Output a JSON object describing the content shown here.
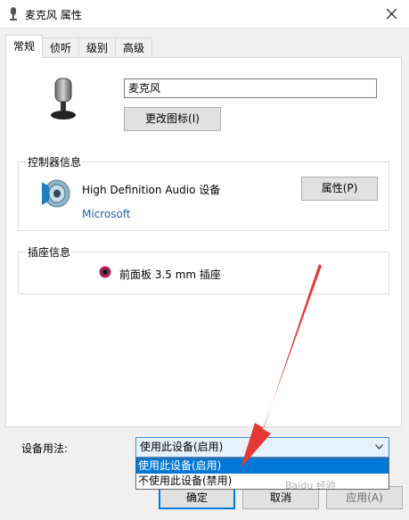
{
  "window": {
    "title": "麦克风 属性",
    "close_icon": "close-icon",
    "title_icon": "microphone-icon"
  },
  "tabs": [
    {
      "label": "常规",
      "active": true
    },
    {
      "label": "侦听",
      "active": false
    },
    {
      "label": "级别",
      "active": false
    },
    {
      "label": "高级",
      "active": false
    }
  ],
  "general": {
    "device_name_value": "麦克风",
    "change_icon_label": "更改图标(I)",
    "controller": {
      "legend": "控制器信息",
      "device": "High Definition Audio 设备",
      "vendor": "Microsoft",
      "properties_label": "属性(P)"
    },
    "jack": {
      "legend": "插座信息",
      "label": "前面板 3.5 mm 插座",
      "color": "#c2185b"
    },
    "usage": {
      "label": "设备用法:",
      "selected": "使用此设备(启用)",
      "options": [
        "使用此设备(启用)",
        "不使用此设备(禁用)"
      ]
    }
  },
  "buttons": {
    "ok": "确定",
    "cancel": "取消",
    "apply": "应用(A)"
  },
  "annotation": {
    "arrow_color": "#e53935"
  },
  "colors": {
    "accent": "#0078d7",
    "vendor_link": "#1f5faa"
  }
}
